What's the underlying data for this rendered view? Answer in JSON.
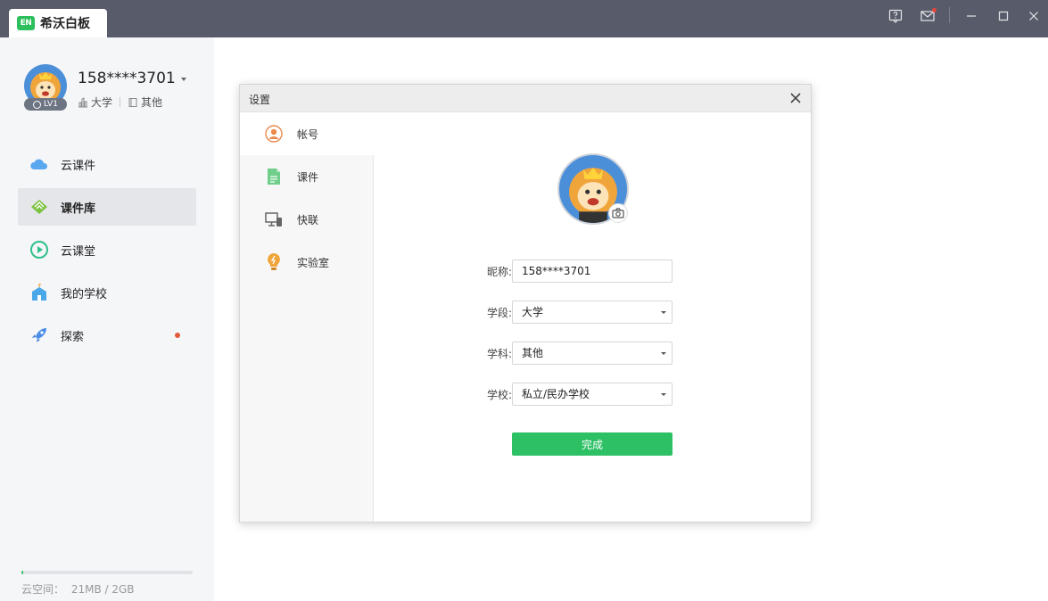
{
  "app": {
    "title": "希沃白板",
    "logo_text": "EN"
  },
  "window_controls": [
    "help-icon",
    "mail-icon",
    "minimize-icon",
    "maximize-icon",
    "close-icon"
  ],
  "user": {
    "name": "158****3701",
    "level": "LV1",
    "stage": "大学",
    "subject": "其他"
  },
  "nav": {
    "items": [
      {
        "label": "云课件",
        "icon": "cloud-icon"
      },
      {
        "label": "课件库",
        "icon": "library-icon",
        "active": true
      },
      {
        "label": "云课堂",
        "icon": "play-icon"
      },
      {
        "label": "我的学校",
        "icon": "school-icon"
      },
      {
        "label": "探索",
        "icon": "rocket-icon",
        "badge": true
      }
    ]
  },
  "storage": {
    "label": "云空间：",
    "value": "21MB / 2GB",
    "used_fraction": 0.01
  },
  "dialog": {
    "title": "设置",
    "tabs": [
      {
        "label": "帐号",
        "icon": "account-icon",
        "active": true
      },
      {
        "label": "课件",
        "icon": "document-icon"
      },
      {
        "label": "快联",
        "icon": "screen-link-icon"
      },
      {
        "label": "实验室",
        "icon": "lightbulb-icon"
      }
    ],
    "form": {
      "nickname_label": "昵称:",
      "nickname_value": "158****3701",
      "stage_label": "学段:",
      "stage_value": "大学",
      "subject_label": "学科:",
      "subject_value": "其他",
      "school_label": "学校:",
      "school_value": "私立/民办学校"
    },
    "submit_label": "完成"
  },
  "colors": {
    "accent": "#2ec065",
    "titlebar": "#585c6a",
    "sidebar": "#f5f6f8"
  }
}
